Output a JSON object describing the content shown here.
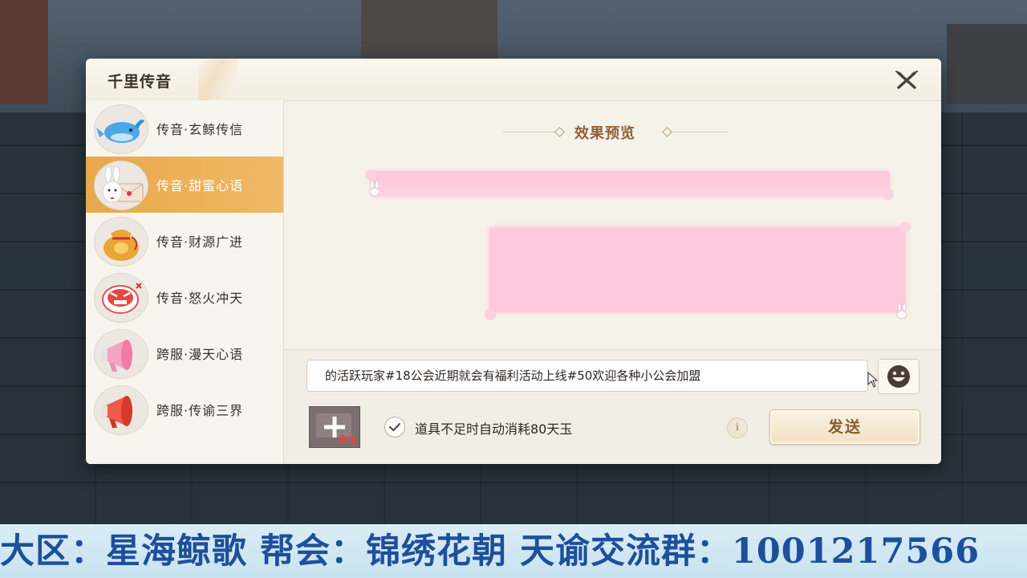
{
  "dialog": {
    "title": "千里传音"
  },
  "sidebar": {
    "items": [
      {
        "label": "传音·玄鲸传信",
        "icon": "whale-icon"
      },
      {
        "label": "传音·甜蜜心语",
        "icon": "bunny-letter-icon",
        "selected": true
      },
      {
        "label": "传音·财源广进",
        "icon": "money-bag-icon"
      },
      {
        "label": "传音·怒火冲天",
        "icon": "angry-face-icon"
      },
      {
        "label": "跨服·漫天心语",
        "icon": "megaphone-pink-icon"
      },
      {
        "label": "跨服·传谕三界",
        "icon": "megaphone-red-icon"
      }
    ]
  },
  "preview": {
    "title": "效果预览"
  },
  "composer": {
    "message": "的活跃玩家#18公会近期就会有福利活动上线#50欢迎各种小公会加盟",
    "item_count": "0/1",
    "auto_consume_label": "道具不足时自动消耗80天玉",
    "auto_consume_checked": true,
    "info_glyph": "i",
    "send_label": "发送"
  },
  "banner": {
    "text": "大区：星海鲸歌 帮会：锦绣花朝 天谕交流群：1001217566"
  },
  "colors": {
    "accent": "#e8a84c",
    "bubble": "#ffc9dd",
    "banner_text": "#1e4f9a"
  }
}
